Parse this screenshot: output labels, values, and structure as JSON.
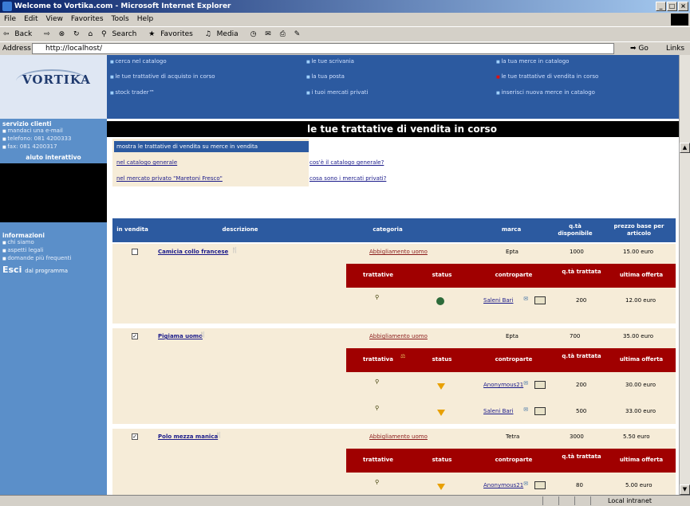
{
  "window": {
    "title": "Welcome to Vortika.com - Microsoft Internet Explorer",
    "menu": [
      "File",
      "Edit",
      "View",
      "Favorites",
      "Tools",
      "Help"
    ],
    "toolbar": [
      "Back",
      "Search",
      "Favorites",
      "Media"
    ],
    "address_label": "Address",
    "address_value": "http://localhost/",
    "go_label": "Go",
    "links_label": "Links",
    "status_zone": "Local intranet"
  },
  "logo": {
    "text": "VORTIKA"
  },
  "nav": {
    "col1": [
      "cerca nel catalogo",
      "le tue trattative di acquisto in corso",
      "stock trader™"
    ],
    "col2": [
      "le tue scrivania",
      "la tua posta",
      "i tuoi mercati privati"
    ],
    "col3": [
      "la tua merce in catalogo",
      "le tue trattative di vendita in corso",
      "inserisci nuova merce in catalogo"
    ]
  },
  "sidebar": {
    "client_title": "servizio clienti",
    "client_items": [
      "mandaci una e-mail",
      "telefono: 081 4200333",
      "fax: 081 4200317"
    ],
    "help": "aiuto interattivo",
    "info_title": "informazioni",
    "info_items": [
      "chi siamo",
      "aspetti legali",
      "domande più frequenti"
    ],
    "exit_strong": "Esci",
    "exit_rest": "dal programma"
  },
  "page_title": "le tue trattative di vendita in corso",
  "filter": {
    "head": "mostra le trattative di vendita su merce in vendita",
    "link1": "nel catalogo generale",
    "link2": "nel mercato privato \"Maretoni Fresco\"",
    "help1": "cos'è il catalogo generale?",
    "help2": "cosa sono i mercati privati?"
  },
  "columns": [
    "in vendita",
    "descrizione",
    "categoria",
    "marca",
    "q.tà disponibile",
    "prezzo base per articolo"
  ],
  "sub_columns": [
    "trattative",
    "status",
    "controparte",
    "q.tà trattata",
    "ultima offerta"
  ],
  "sub_columns_alt_first": "trattativa",
  "products": [
    {
      "checked": "",
      "name": "Camicia collo francese",
      "category": "Abbigliamento uomo",
      "brand": "Epta",
      "qty": "1000",
      "price": "15.00 euro",
      "deals": [
        {
          "status": "circle",
          "party": "Saleni Bari",
          "qty": "200",
          "offer": "12.00 euro"
        }
      ]
    },
    {
      "checked": "✓",
      "name": "Pigiama uomo",
      "category": "Abbigliamento uomo",
      "brand": "Epta",
      "qty": "700",
      "price": "35.00 euro",
      "deals": [
        {
          "status": "arrow",
          "party": "Anonymous21",
          "qty": "200",
          "offer": "30.00 euro"
        },
        {
          "status": "arrow",
          "party": "Saleni Bari",
          "qty": "500",
          "offer": "33.00 euro"
        }
      ]
    },
    {
      "checked": "✓",
      "name": "Polo mezza manica",
      "category": "Abbigliamento uomo",
      "brand": "Tetra",
      "qty": "3000",
      "price": "5.50 euro",
      "deals": [
        {
          "status": "arrow",
          "party": "Anonymous21",
          "qty": "80",
          "offer": "5.00 euro"
        }
      ]
    }
  ],
  "colors": {
    "nav_blue": "#2c5aa0",
    "sidebar_blue": "#5b8fc9",
    "deal_red": "#a00000",
    "row_beige": "#f6ecd8"
  }
}
